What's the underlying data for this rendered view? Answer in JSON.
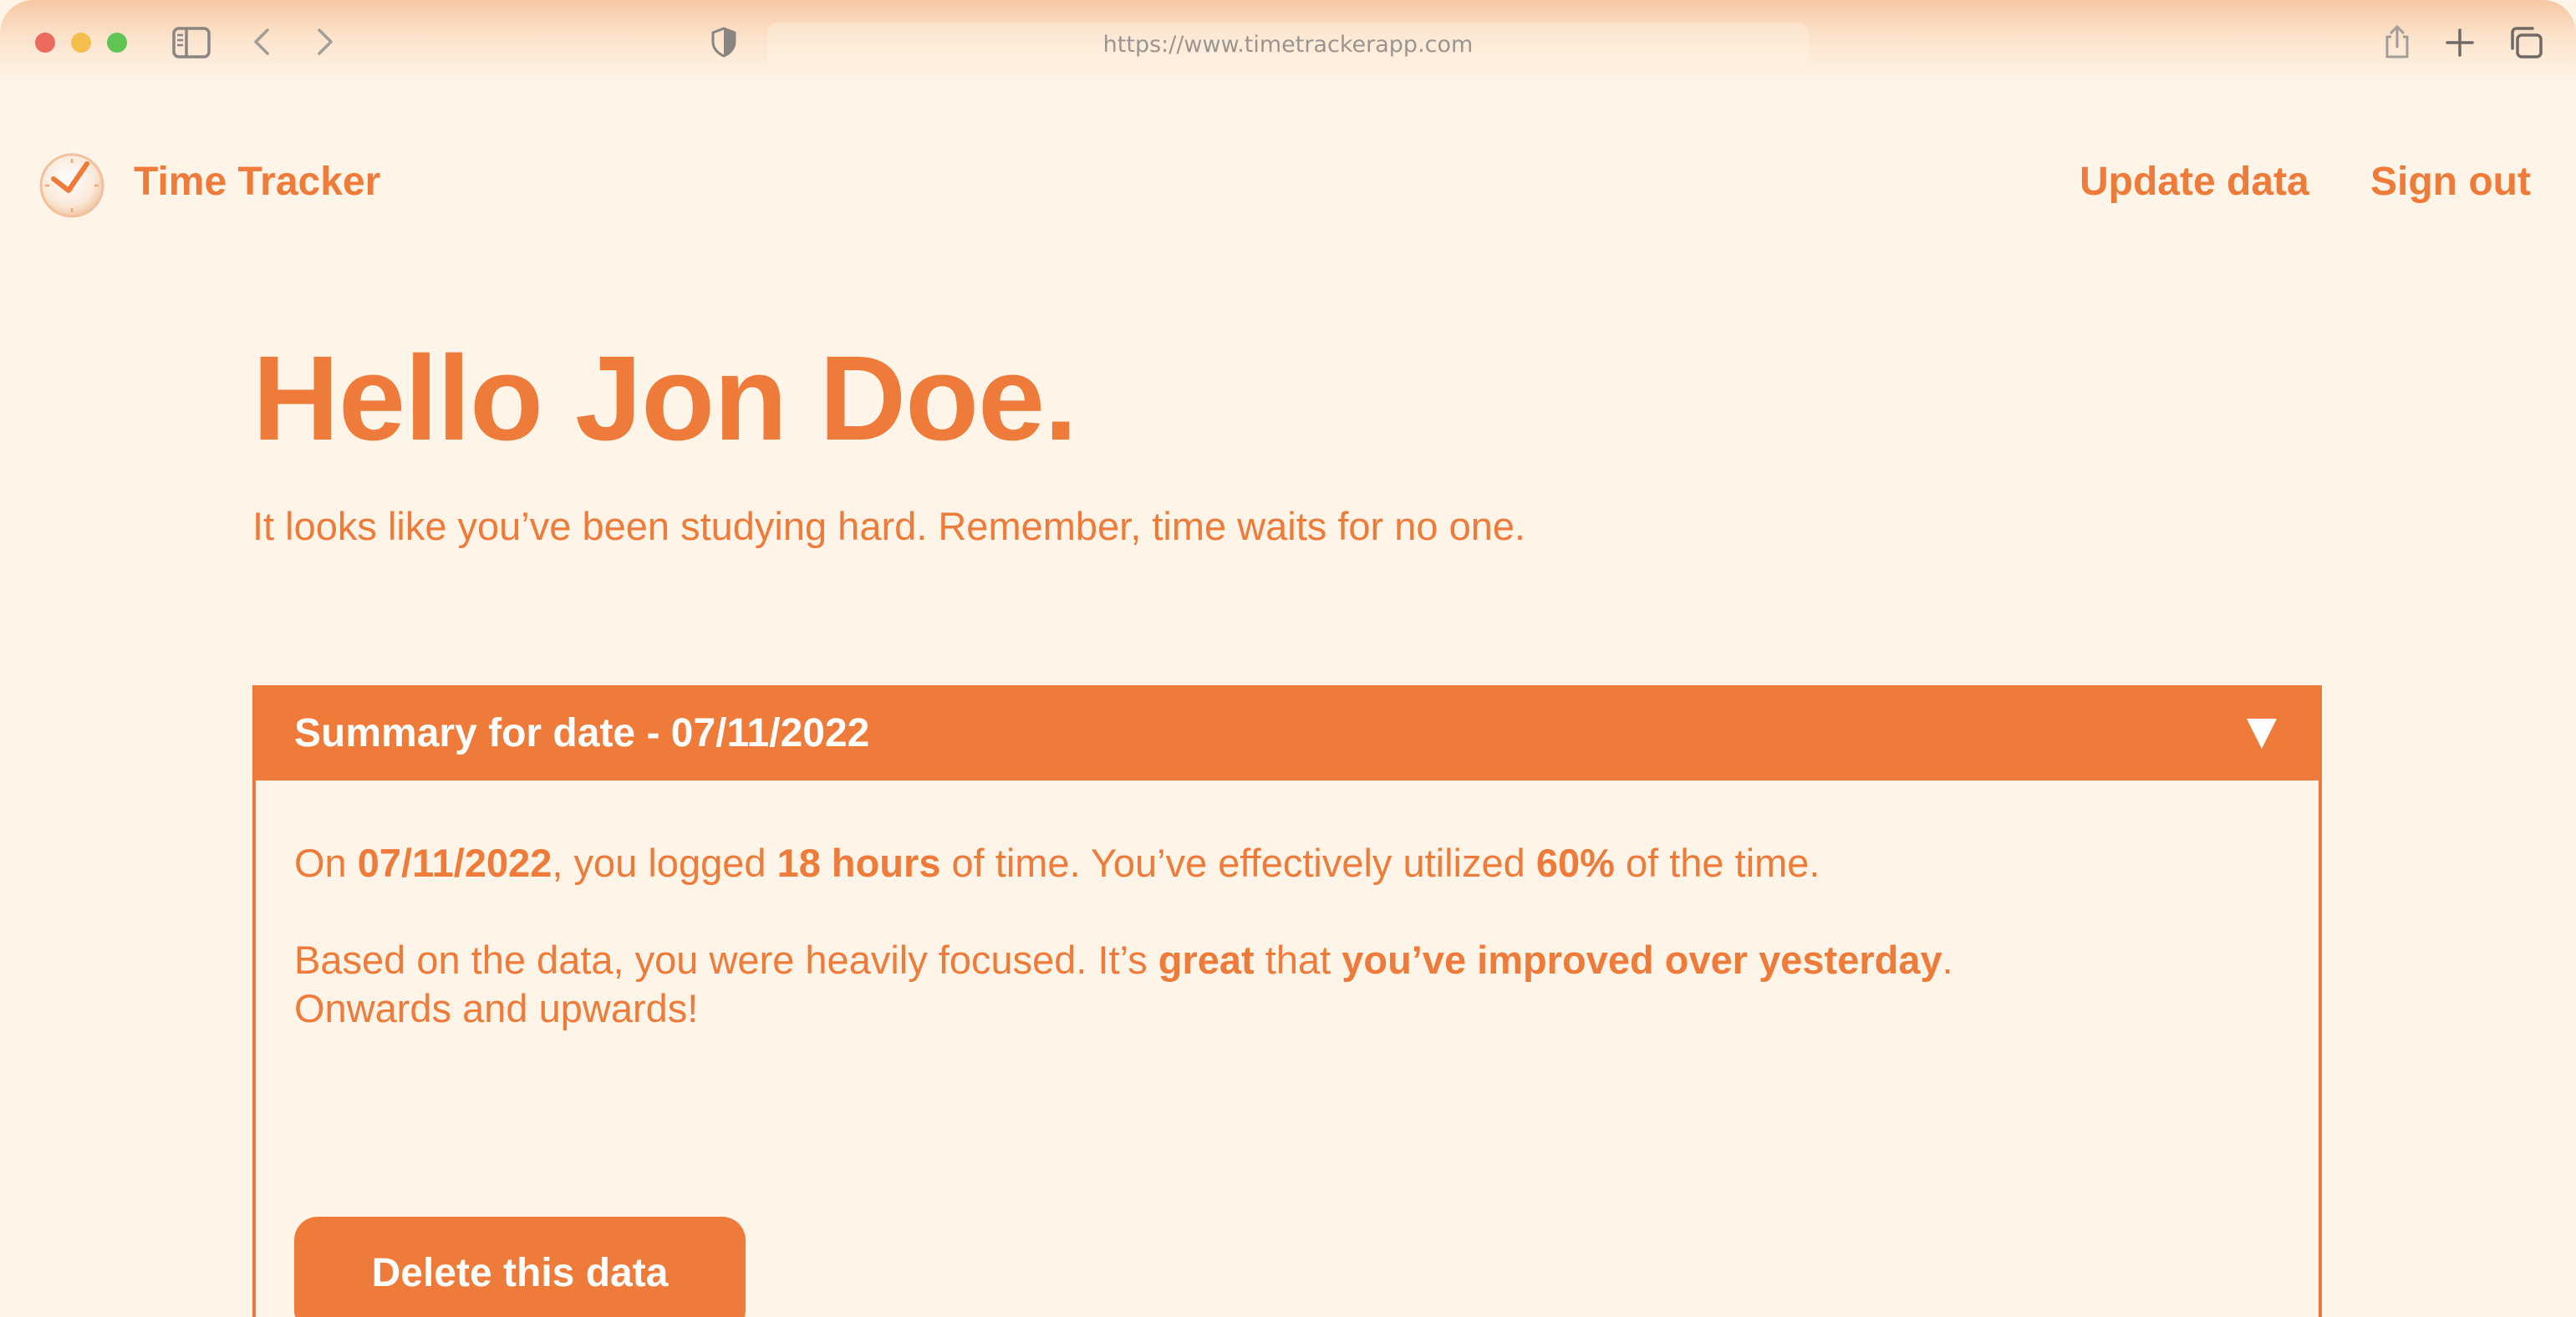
{
  "browser": {
    "url": "https://www.timetrackerapp.com"
  },
  "app": {
    "brand": "Time Tracker",
    "nav": {
      "update_data": "Update data",
      "sign_out": "Sign out"
    }
  },
  "hero": {
    "title": "Hello Jon Doe.",
    "subtitle": "It looks like you’ve been studying hard. Remember, time waits for no one."
  },
  "summary": {
    "title": "Summary for date - 07/11/2022",
    "toggle_icon": "triangle-down-icon",
    "p1": {
      "t1": "On ",
      "date": "07/11/2022",
      "t2": ", you logged ",
      "hours": "18 hours",
      "t3": " of time. You’ve effectively utilized ",
      "percent": "60%",
      "t4": " of the time."
    },
    "p2": {
      "t1": "Based on the data, you were heavily focused. It’s ",
      "great": "great",
      "t2": " that ",
      "improved": "you’ve improved over yesterday",
      "t3": ".",
      "line2": "Onwards and upwards!"
    },
    "delete_label": "Delete this data"
  },
  "colors": {
    "accent": "#ef7b3a",
    "background": "#fef5e8",
    "on_accent": "#ffffff"
  }
}
